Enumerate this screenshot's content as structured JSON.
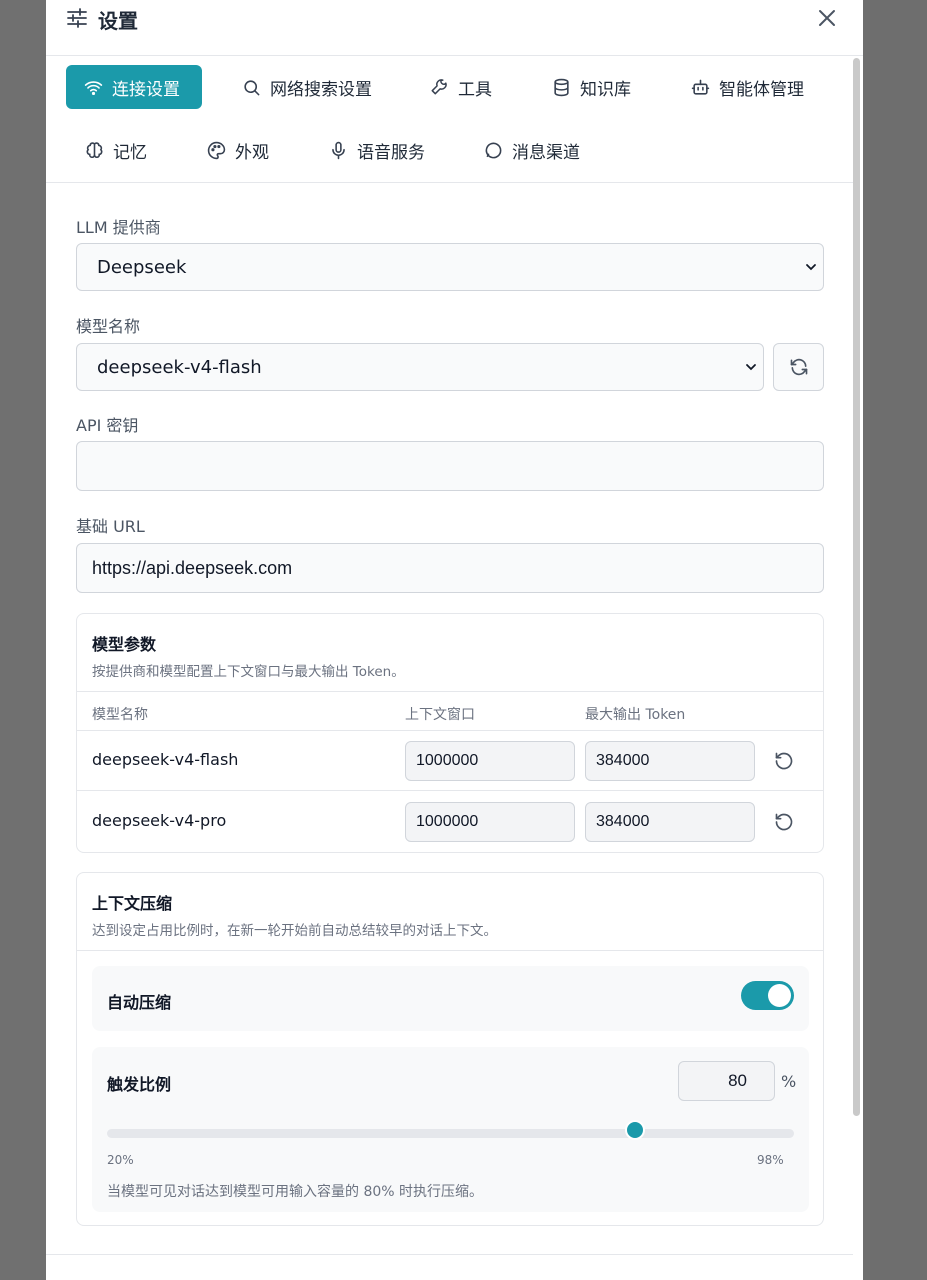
{
  "modal": {
    "title": "设置"
  },
  "tabs": [
    {
      "label": "连接设置",
      "icon": "wifi-icon",
      "active": true
    },
    {
      "label": "网络搜索设置",
      "icon": "search-icon"
    },
    {
      "label": "工具",
      "icon": "wrench-icon"
    },
    {
      "label": "知识库",
      "icon": "database-icon"
    },
    {
      "label": "智能体管理",
      "icon": "bot-icon"
    },
    {
      "label": "记忆",
      "icon": "brain-icon"
    },
    {
      "label": "外观",
      "icon": "palette-icon"
    },
    {
      "label": "语音服务",
      "icon": "mic-icon"
    },
    {
      "label": "消息渠道",
      "icon": "chat-icon"
    }
  ],
  "form": {
    "provider_label": "LLM 提供商",
    "provider_value": "Deepseek",
    "model_label": "模型名称",
    "model_value": "deepseek-v4-flash",
    "api_key_label": "API 密钥",
    "api_key_value": "",
    "base_url_label": "基础 URL",
    "base_url_value": "https://api.deepseek.com"
  },
  "model_params": {
    "title": "模型参数",
    "description": "按提供商和模型配置上下文窗口与最大输出 Token。",
    "columns": [
      "模型名称",
      "上下文窗口",
      "最大输出 Token"
    ],
    "rows": [
      {
        "name": "deepseek-v4-flash",
        "context": "1000000",
        "max_output": "384000"
      },
      {
        "name": "deepseek-v4-pro",
        "context": "1000000",
        "max_output": "384000"
      }
    ]
  },
  "compression": {
    "title": "上下文压缩",
    "description": "达到设定占用比例时，在新一轮开始前自动总结较早的对话上下文。",
    "auto_label": "自动压缩",
    "auto_enabled": true,
    "ratio_label": "触发比例",
    "ratio_value": "80",
    "ratio_unit": "%",
    "ratio_fraction": 0.7692,
    "slider_min": "20%",
    "slider_max": "98%",
    "hint": "当模型可见对话达到模型可用输入容量的 80% 时执行压缩。"
  },
  "colors": {
    "accent": "#1b9aaa"
  }
}
